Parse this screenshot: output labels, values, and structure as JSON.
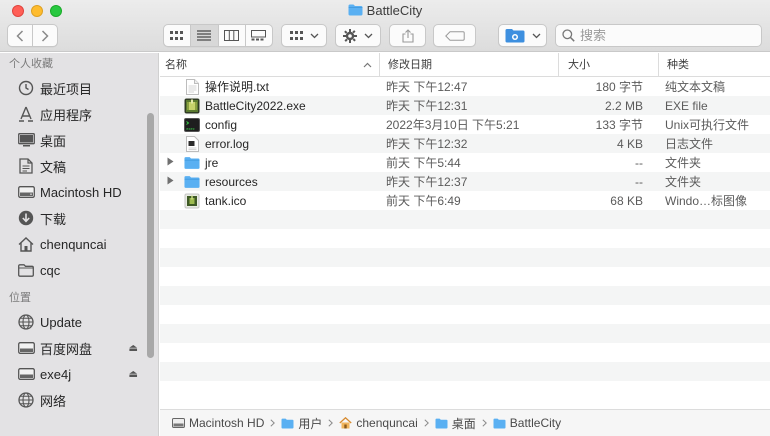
{
  "window": {
    "title": "BattleCity"
  },
  "toolbar": {
    "search_placeholder": "搜索"
  },
  "sidebar": {
    "sections": [
      {
        "label": "个人收藏",
        "items": [
          {
            "label": "最近项目",
            "icon": "clock-icon"
          },
          {
            "label": "应用程序",
            "icon": "apps-icon"
          },
          {
            "label": "桌面",
            "icon": "desktop-icon"
          },
          {
            "label": "文稿",
            "icon": "document-icon"
          },
          {
            "label": "Macintosh HD",
            "icon": "harddisk-icon"
          },
          {
            "label": "下载",
            "icon": "download-icon"
          },
          {
            "label": "chenquncai",
            "icon": "home-icon"
          },
          {
            "label": "cqc",
            "icon": "folder-icon"
          }
        ]
      },
      {
        "label": "位置",
        "items": [
          {
            "label": "Update",
            "icon": "globe-icon"
          },
          {
            "label": "百度网盘",
            "icon": "disk-icon",
            "eject": "⏏"
          },
          {
            "label": "exe4j",
            "icon": "disk-icon",
            "eject": "⏏"
          },
          {
            "label": "网络",
            "icon": "globe-icon"
          }
        ]
      }
    ]
  },
  "columns": {
    "name": "名称",
    "date": "修改日期",
    "size": "大小",
    "kind": "种类"
  },
  "files": [
    {
      "name": "操作说明.txt",
      "date": "昨天 下午12:47",
      "size": "180 字节",
      "kind": "纯文本文稿",
      "icon": "text-file-icon",
      "folder": false
    },
    {
      "name": "BattleCity2022.exe",
      "date": "昨天 下午12:31",
      "size": "2.2 MB",
      "kind": "EXE file",
      "icon": "exe-icon",
      "folder": false
    },
    {
      "name": "config",
      "date": "2022年3月10日 下午5:21",
      "size": "133 字节",
      "kind": "Unix可执行文件",
      "icon": "terminal-icon",
      "folder": false
    },
    {
      "name": "error.log",
      "date": "昨天 下午12:32",
      "size": "4 KB",
      "kind": "日志文件",
      "icon": "log-file-icon",
      "folder": false
    },
    {
      "name": "jre",
      "date": "前天 下午5:44",
      "size": "--",
      "kind": "文件夹",
      "icon": "folder-icon",
      "folder": true
    },
    {
      "name": "resources",
      "date": "昨天 下午12:37",
      "size": "--",
      "kind": "文件夹",
      "icon": "folder-icon",
      "folder": true
    },
    {
      "name": "tank.ico",
      "date": "前天 下午6:49",
      "size": "68 KB",
      "kind": "Windo…标图像",
      "icon": "image-icon",
      "folder": false
    }
  ],
  "pathbar": [
    {
      "label": "Macintosh HD",
      "icon": "harddisk-icon"
    },
    {
      "label": "用户",
      "icon": "folder-icon"
    },
    {
      "label": "chenquncai",
      "icon": "home-icon"
    },
    {
      "label": "桌面",
      "icon": "folder-icon"
    },
    {
      "label": "BattleCity",
      "icon": "folder-icon"
    }
  ],
  "colors": {
    "folder": "#5ab0f2",
    "sidebar_bg": "#e3e2e4"
  }
}
